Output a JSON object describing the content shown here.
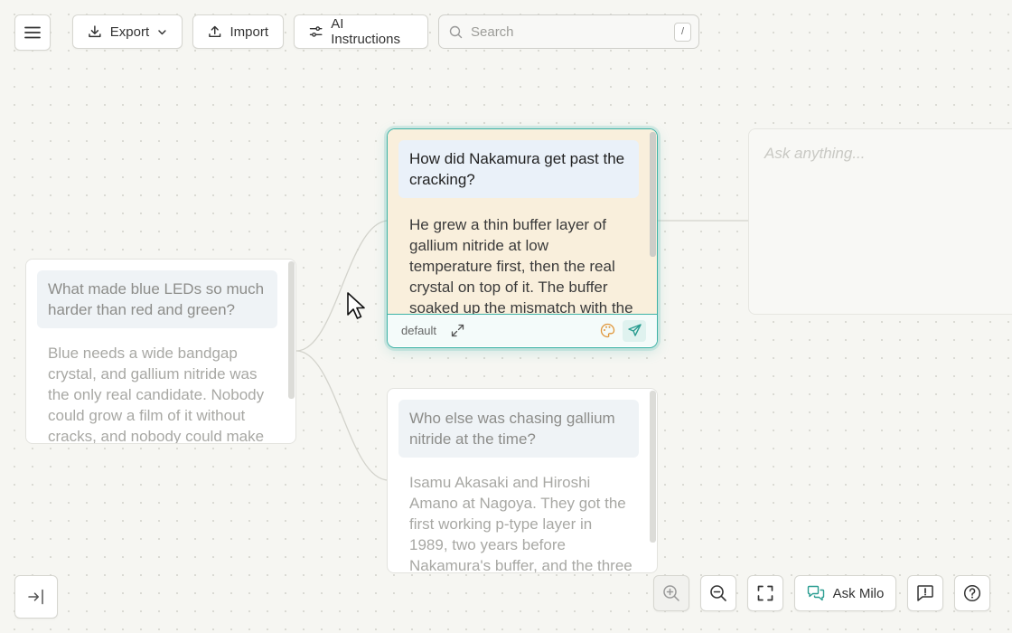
{
  "toolbar": {
    "menu_icon": "hamburger-menu-icon",
    "export_label": "Export",
    "import_label": "Import",
    "ai_instructions_label": "AI Instructions",
    "search_placeholder": "Search",
    "search_shortcut": "/"
  },
  "canvas": {
    "cards": [
      {
        "question": "What made blue LEDs so much harder than red and green?",
        "answer": "Blue needs a wide bandgap crystal, and gallium nitride was the only real candidate. Nobody could grow a film of it without cracks, and nobody could make it carry",
        "state": "faded"
      },
      {
        "question": "How did Nakamura get past the cracking?",
        "answer": "He grew a thin buffer layer of gallium nitride at low temperature first, then the real crystal on top of it. The buffer soaked up the mismatch with the sapphire",
        "state": "active",
        "mode": "default"
      },
      {
        "question": "Who else was chasing gallium nitride at the time?",
        "answer": "Isamu Akasaki and Hiroshi Amano at Nagoya. They got the first working p-type layer in 1989, two years before Nakamura's buffer, and the three of them shared the",
        "state": "faded"
      }
    ],
    "ask_placeholder": "Ask anything..."
  },
  "bottom_bar": {
    "ask_milo_label": "Ask Milo"
  },
  "colors": {
    "accent": "#3fb3a7",
    "active_card_bg": "#f9efdc",
    "question_bg": "#eaf1f9"
  }
}
